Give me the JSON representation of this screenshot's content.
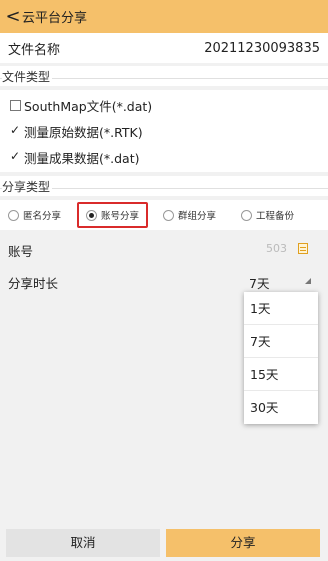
{
  "header": {
    "back_label": "<",
    "title": "云平台分享"
  },
  "file": {
    "name_label": "文件名称",
    "name_value": "20211230093835"
  },
  "file_type": {
    "section_label": "文件类型",
    "options": [
      {
        "label": "SouthMap文件(*.dat)",
        "checked": false
      },
      {
        "label": "测量原始数据(*.RTK)",
        "checked": true
      },
      {
        "label": "测量成果数据(*.dat)",
        "checked": true
      }
    ]
  },
  "share_type": {
    "section_label": "分享类型",
    "options": [
      {
        "label": "匿名分享",
        "selected": false
      },
      {
        "label": "账号分享",
        "selected": true
      },
      {
        "label": "群组分享",
        "selected": false
      },
      {
        "label": "工程备份",
        "selected": false
      }
    ]
  },
  "account": {
    "label": "账号",
    "value": "503"
  },
  "duration": {
    "label": "分享时长",
    "value": "7天",
    "options": [
      "1天",
      "7天",
      "15天",
      "30天"
    ]
  },
  "actions": {
    "cancel_label": "取消",
    "share_label": "分享"
  },
  "colors": {
    "accent": "#f5c06a",
    "highlight_border": "#d92b2b"
  }
}
